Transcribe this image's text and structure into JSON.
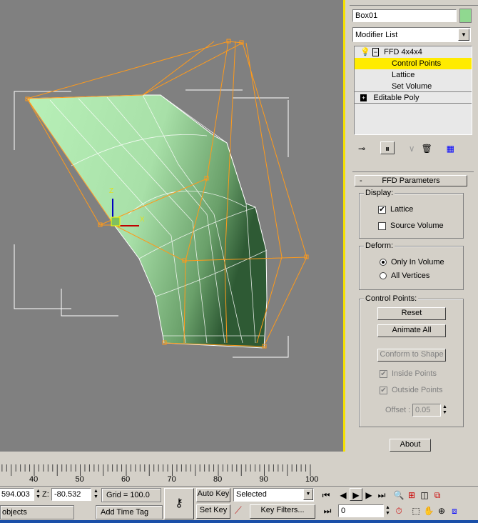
{
  "command_panel": {
    "object_name": "Box01",
    "object_color": "#90d890",
    "modifier_list": "Modifier List",
    "stack": [
      {
        "label": "FFD 4x4x4",
        "icon": "lightbulb-icon",
        "expander": "minus"
      },
      {
        "label": "Control Points",
        "selected": true
      },
      {
        "label": "Lattice"
      },
      {
        "label": "Set Volume"
      },
      {
        "label": "Editable Poly",
        "expander": "plus"
      }
    ],
    "rollout_title": "FFD Parameters",
    "rollout_toggle": "-",
    "display": {
      "label": "Display:",
      "lattice": "Lattice",
      "lattice_checked": true,
      "source_volume": "Source Volume",
      "source_volume_checked": false
    },
    "deform": {
      "label": "Deform:",
      "only_in_volume": "Only In Volume",
      "all_vertices": "All Vertices",
      "selected": "Only In Volume"
    },
    "control_points": {
      "label": "Control Points:",
      "reset": "Reset",
      "animate_all": "Animate All",
      "conform": "Conform to Shape",
      "inside_points": "Inside Points",
      "outside_points": "Outside Points",
      "offset_label": "Offset :",
      "offset_value": "0.05"
    },
    "about": "About"
  },
  "viewport": {
    "gizmo_z": "Z",
    "gizmo_x": "X",
    "gizmo_y": "Y",
    "border_color": "#f5e000",
    "background": "#808080"
  },
  "timeline": {
    "ticks": [
      "40",
      "50",
      "60",
      "70",
      "80",
      "90",
      "100"
    ]
  },
  "status": {
    "y_value": "594.003",
    "z_label": "Z:",
    "z_value": "-80.532",
    "grid": "Grid = 100.0",
    "objects": "objects",
    "add_time_tag": "Add Time Tag",
    "auto_key": "Auto Key",
    "set_key": "Set Key",
    "selected": "Selected",
    "key_filters": "Key Filters...",
    "frame": "0"
  }
}
